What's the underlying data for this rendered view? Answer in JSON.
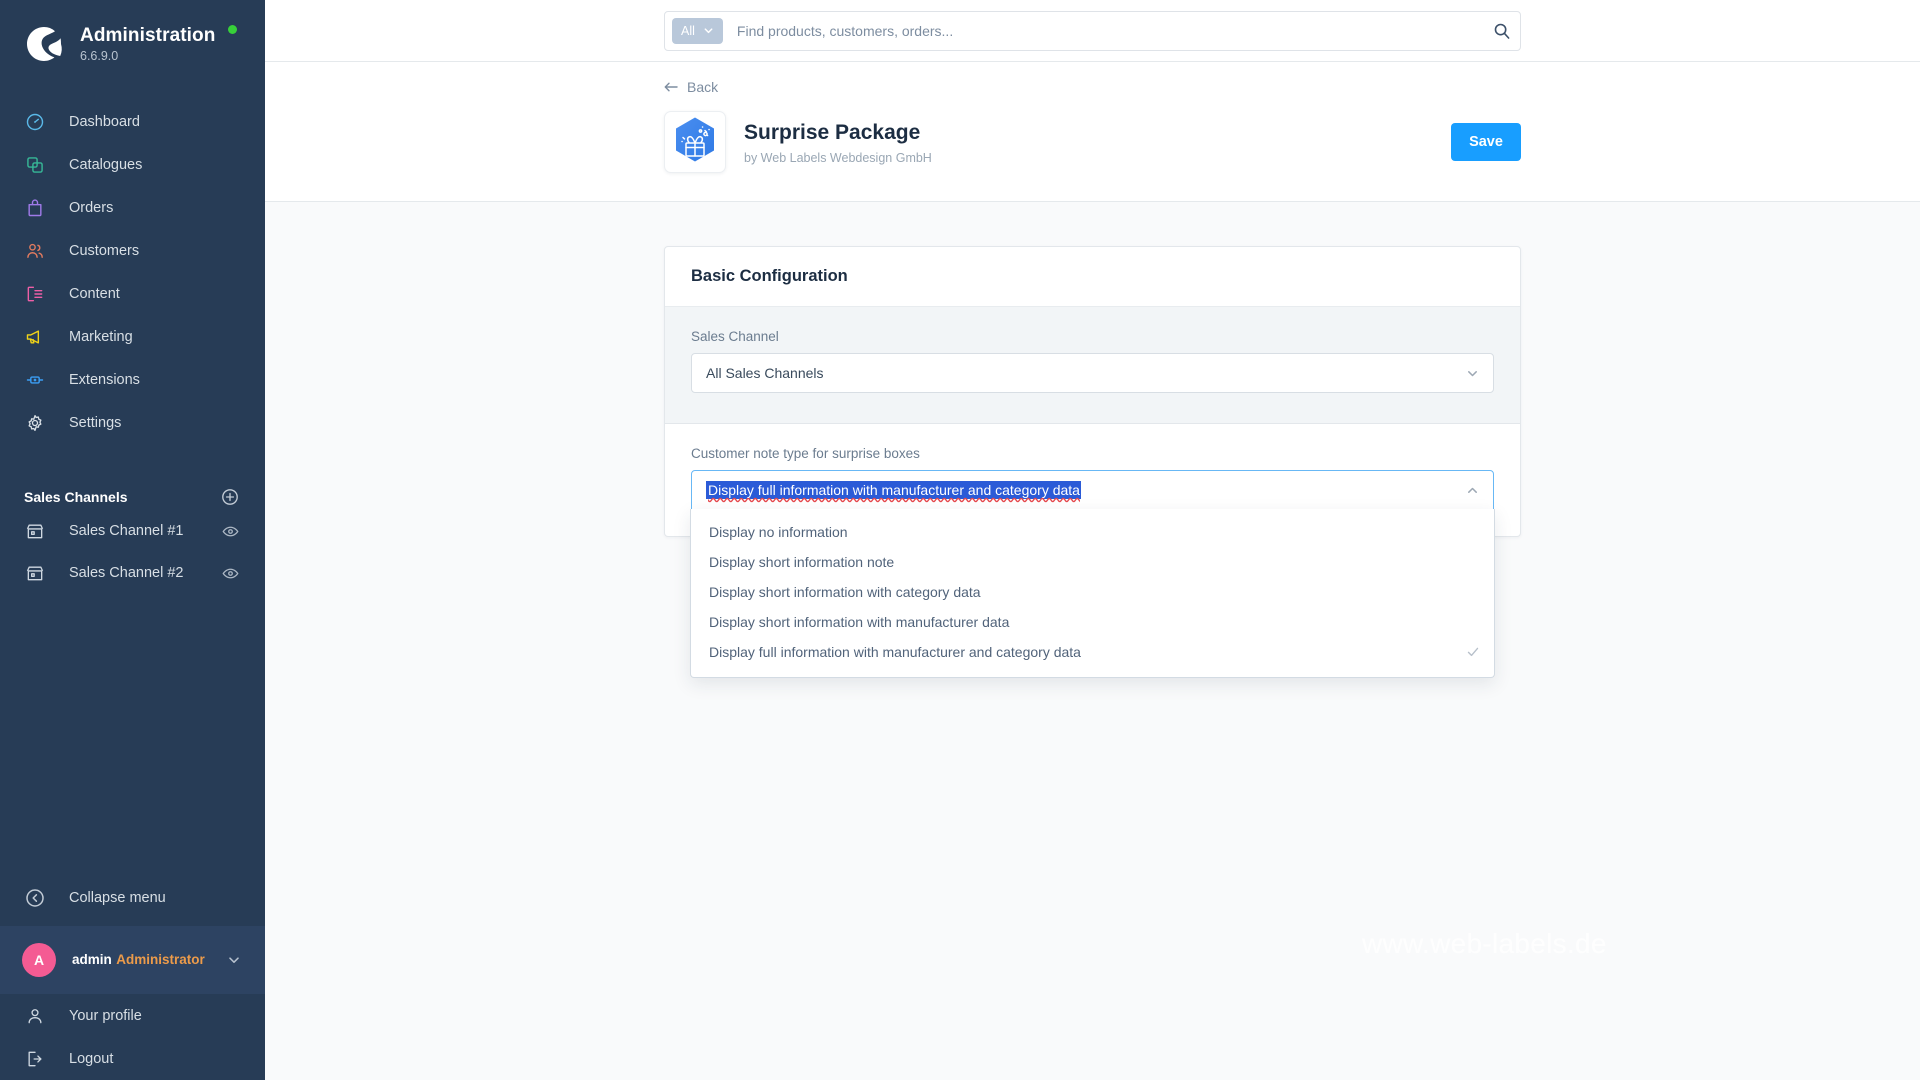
{
  "sidebar": {
    "brand": {
      "title": "Administration",
      "version": "6.6.9.0",
      "status_color": "#37d039"
    },
    "nav": [
      {
        "label": "Dashboard",
        "icon": "gauge-icon",
        "color": "#5ab9e8"
      },
      {
        "label": "Catalogues",
        "icon": "copy-icon",
        "color": "#37b897"
      },
      {
        "label": "Orders",
        "icon": "bag-icon",
        "color": "#9f7ae8"
      },
      {
        "label": "Customers",
        "icon": "users-icon",
        "color": "#e07a5f"
      },
      {
        "label": "Content",
        "icon": "content-icon",
        "color": "#ee5fa7"
      },
      {
        "label": "Marketing",
        "icon": "megaphone-icon",
        "color": "#f0d318"
      },
      {
        "label": "Extensions",
        "icon": "plug-icon",
        "color": "#3b9ef5"
      },
      {
        "label": "Settings",
        "icon": "gear-icon",
        "color": "#d9e0e6"
      }
    ],
    "sales_channels": {
      "title": "Sales Channels",
      "add_label": "+",
      "items": [
        {
          "label": "Sales Channel #1"
        },
        {
          "label": "Sales Channel #2"
        }
      ]
    },
    "collapse_label": "Collapse menu",
    "user": {
      "initial": "A",
      "name": "admin",
      "role": "Administrator",
      "avatar_color": "#f45b93"
    },
    "bottom": [
      {
        "label": "Your profile",
        "icon": "person-icon"
      },
      {
        "label": "Logout",
        "icon": "logout-icon"
      }
    ]
  },
  "search": {
    "scope_label": "All",
    "placeholder": "Find products, customers, orders..."
  },
  "header": {
    "back_label": "Back",
    "plugin_name": "Surprise Package",
    "plugin_author": "by Web Labels Webdesign GmbH",
    "save_label": "Save",
    "accent_color": "#189eff"
  },
  "card": {
    "title": "Basic Configuration",
    "sales_channel": {
      "label": "Sales Channel",
      "value": "All Sales Channels"
    },
    "note_type": {
      "label": "Customer note type for surprise boxes",
      "value": "Display full information with manufacturer and category data",
      "selection_color": "#2b5bd7",
      "options": [
        {
          "label": "Display no information",
          "selected": false
        },
        {
          "label": "Display short information note",
          "selected": false
        },
        {
          "label": "Display short information with category data",
          "selected": false
        },
        {
          "label": "Display short information with manufacturer data",
          "selected": false
        },
        {
          "label": "Display full information with manufacturer and category data",
          "selected": true
        }
      ]
    }
  },
  "watermark": {
    "text": "www.web-labels.de"
  }
}
